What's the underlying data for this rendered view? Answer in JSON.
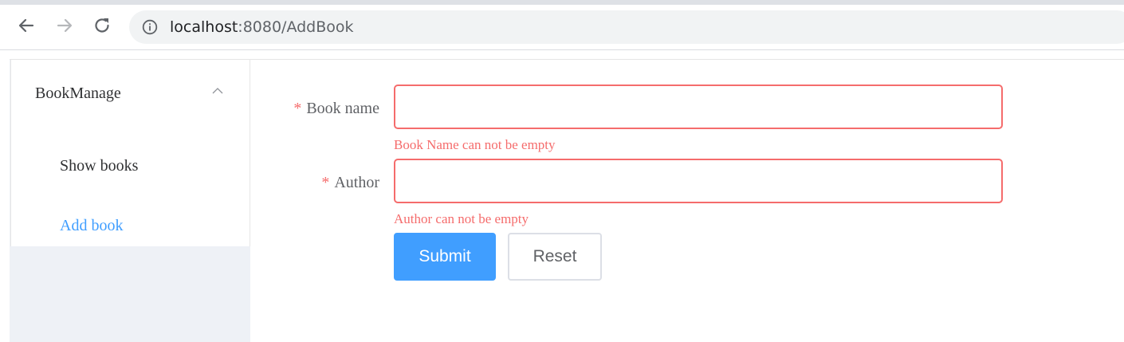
{
  "browser": {
    "url_host": "localhost",
    "url_path": ":8080/AddBook",
    "icons": {
      "back": "back-arrow-icon",
      "forward": "forward-arrow-icon",
      "reload": "reload-icon",
      "site_info": "info-icon"
    }
  },
  "sidebar": {
    "group_title": "BookManage",
    "group_icon": "chevron-up-icon",
    "items": [
      {
        "label": "Show books",
        "active": false
      },
      {
        "label": "Add book",
        "active": true
      }
    ]
  },
  "form": {
    "fields": [
      {
        "label": "Book name",
        "required_mark": "*",
        "value": "",
        "error": "Book Name can not be empty"
      },
      {
        "label": "Author",
        "required_mark": "*",
        "value": "",
        "error": "Author can not be empty"
      }
    ],
    "submit_label": "Submit",
    "reset_label": "Reset"
  },
  "colors": {
    "primary": "#409eff",
    "danger": "#f56c6c",
    "text_regular": "#606266",
    "sidebar_bg": "#eef1f6"
  }
}
